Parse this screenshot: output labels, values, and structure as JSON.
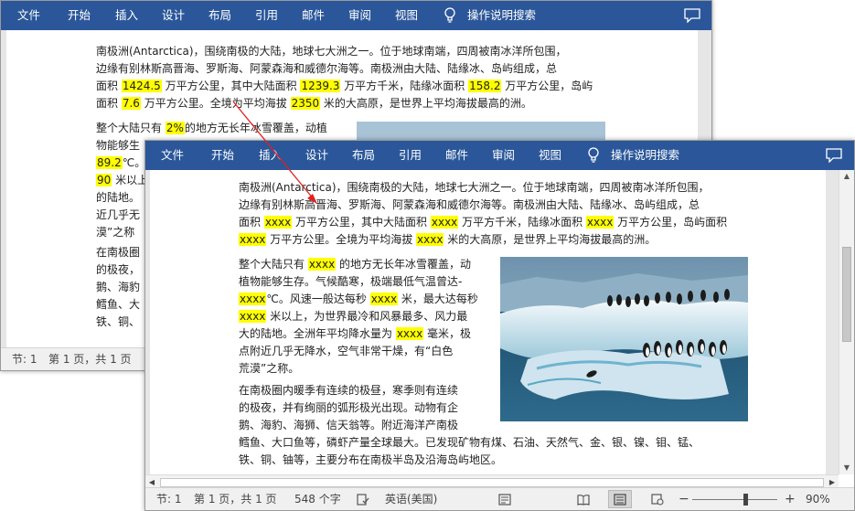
{
  "ribbon": {
    "tabs": [
      "文件",
      "开始",
      "插入",
      "设计",
      "布局",
      "引用",
      "邮件",
      "审阅",
      "视图"
    ],
    "search_label": "操作说明搜索"
  },
  "back_window": {
    "paragraph1": [
      [
        "南极洲(Antarctica)，围绕南极的大陆，地球七大洲之一。位于地球南端，四周被南冰洋所包围，"
      ],
      [
        "边缘有别林斯高晋海、罗斯海、阿蒙森海和威德尔海等。南极洲由大陆、陆缘冰、岛屿组成，总"
      ],
      [
        "面积 ",
        {
          "hl": "1424.5"
        },
        " 万平方公里，其中大陆面积 ",
        {
          "hl": "1239.3"
        },
        " 万平方千米，陆缘冰面积 ",
        {
          "hl": "158.2"
        },
        " 万平方公里，岛屿"
      ],
      [
        "面积 ",
        {
          "hl": "7.6"
        },
        " 万平方公里。全境为平均海拔 ",
        {
          "hl": "2350"
        },
        " 米的大高原，是世界上平均海拔最高的洲。"
      ]
    ],
    "paragraph2": [
      [
        "整个大陆只有 ",
        {
          "hl": "2%"
        },
        "的地方无长年冰雪覆盖，动植"
      ],
      [
        "物能够生"
      ],
      [
        {
          "hl": "89.2"
        },
        "℃。"
      ],
      [
        {
          "hl": "90"
        },
        " 米以上"
      ],
      [
        "的陆地。"
      ],
      [
        "近几乎无"
      ],
      [
        "漠”之称"
      ]
    ],
    "paragraph3": [
      [
        "在南极圈"
      ],
      [
        "的极夜，"
      ],
      [
        "鹅、海豹"
      ],
      [
        "鳕鱼、大"
      ],
      [
        "铁、铜、"
      ]
    ],
    "status": {
      "section": "节: 1",
      "page": "第 1 页，共 1 页"
    }
  },
  "front_window": {
    "paragraph1": [
      [
        "南极洲(Antarctica)，围绕南极的大陆，地球七大洲之一。位于地球南端，四周被南冰洋所包围，"
      ],
      [
        "边缘有别林斯高晋海、罗斯海、阿蒙森海和威德尔海等。南极洲由大陆、陆缘冰、岛屿组成，总"
      ],
      [
        "面积 ",
        {
          "hl": "xxxx"
        },
        " 万平方公里，其中大陆面积 ",
        {
          "hl": "xxxx"
        },
        " 万平方千米，陆缘冰面积 ",
        {
          "hl": "xxxx"
        },
        " 万平方公里，岛屿面积"
      ],
      [
        {
          "hl": "xxxx"
        },
        " 万平方公里。全境为平均海拔 ",
        {
          "hl": "xxxx"
        },
        " 米的大高原，是世界上平均海拔最高的洲。"
      ]
    ],
    "paragraph2": [
      [
        "整个大陆只有 ",
        {
          "hl": "xxxx"
        },
        " 的地方无长年冰雪覆盖，动"
      ],
      [
        "植物能够生存。气候酷寒，极端最低气温曾达-"
      ],
      [
        {
          "hl": "xxxx"
        },
        "℃。风速一般达每秒 ",
        {
          "hl": "xxxx"
        },
        " 米，最大达每秒"
      ],
      [
        {
          "hl": "xxxx"
        },
        " 米以上，为世界最冷和风暴最多、风力最"
      ],
      [
        "大的陆地。全洲年平均降水量为 ",
        {
          "hl": "xxxx"
        },
        " 毫米，极"
      ],
      [
        "点附近几乎无降水，空气非常干燥，有“白色"
      ],
      [
        "荒漠”之称。"
      ]
    ],
    "paragraph3": [
      [
        "在南极圈内暖季有连续的极昼，寒季则有连续"
      ],
      [
        "的极夜，并有绚丽的弧形极光出现。动物有企"
      ],
      [
        "鹅、海豹、海狮、信天翁等。附近海洋产南极"
      ],
      [
        "鳕鱼、大口鱼等，磷虾产量全球最大。已发现矿物有煤、石油、天然气、金、银、镍、钼、锰、"
      ],
      [
        "铁、铜、铀等，主要分布在南极半岛及沿海岛屿地区。"
      ]
    ],
    "status": {
      "section": "节: 1",
      "page": "第 1 页，共 1 页",
      "words": "548 个字",
      "language": "英语(美国)",
      "zoom": "90%"
    },
    "zoom_fraction": 0.62
  },
  "colors": {
    "ribbon": "#2b579a",
    "highlight": "#ffff00",
    "arrow": "#e02020"
  }
}
